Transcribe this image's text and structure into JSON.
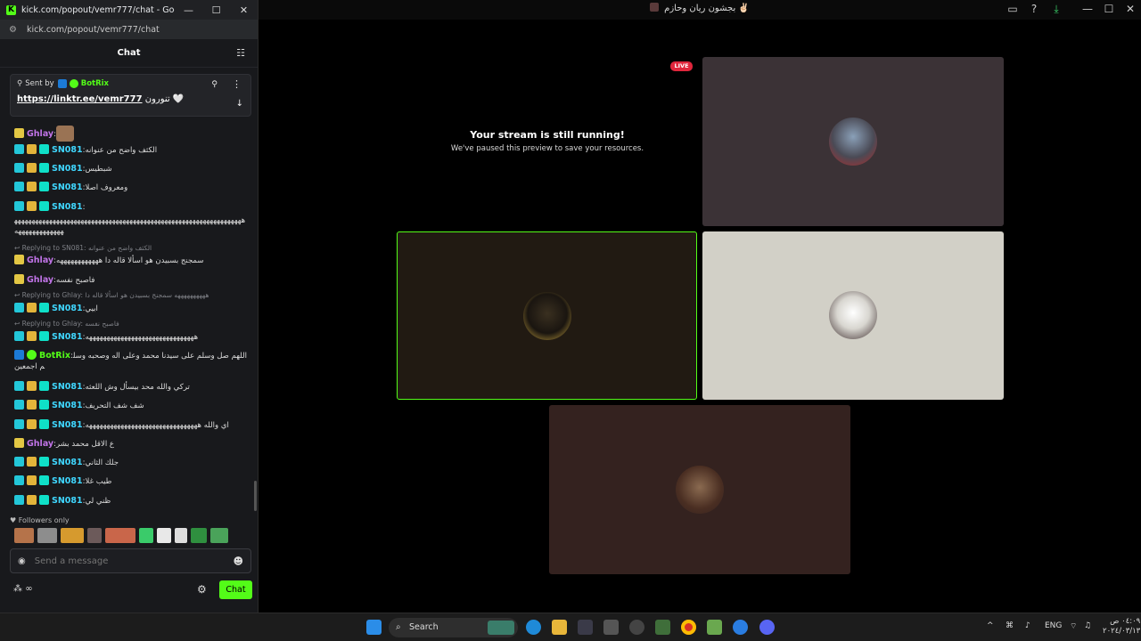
{
  "popout_window": {
    "title": "kick.com/popout/vemr777/chat - Google Chro...",
    "url": "kick.com/popout/vemr777/chat",
    "minimize": "—",
    "maximize": "☐",
    "close": "✕"
  },
  "chat": {
    "header_title": "Chat",
    "pinned": {
      "sent_by_label": "Sent by",
      "sender": "BotRix",
      "link": "https://linktr.ee/vemr777",
      "text": "تنورون 🤍"
    },
    "messages": [
      {
        "user": "Ghlay",
        "text": "",
        "type": "ghlay"
      },
      {
        "user": "SN081",
        "text": ":الكثف واضح من عنوانه",
        "type": "sno"
      },
      {
        "user": "SN081",
        "text": ":شبطيس",
        "type": "sno"
      },
      {
        "user": "SN081",
        "text": ":ومعروف اصلا",
        "type": "sno"
      },
      {
        "user": "SN081",
        "text": ":",
        "type": "sno"
      },
      {
        "user": "",
        "text": "هههههههههههههههههههههههههههههههههههههههههههههههههههههههههههههههههههههههههههههههه",
        "type": "cont"
      },
      {
        "user": "Ghlay",
        "text": ":سمجنج بسبيدن هو اسألا قاله دا ههههههههههههه",
        "type": "ghlay"
      },
      {
        "user": "Ghlay",
        "text": ":فاصبح نفسه",
        "type": "ghlay"
      },
      {
        "user": "SN081",
        "text": ":ابيي",
        "type": "sno"
      },
      {
        "user": "SN081",
        "text": ":هههههههههههههههههههههههههههههههه",
        "type": "sno"
      },
      {
        "user": "BotRix",
        "text": ":اللهم صل وسلم على سيدنا محمد وعلى اله وصحبه وسلم اجمعين",
        "type": "bot"
      },
      {
        "user": "SN081",
        "text": ":تركي والله محد بيسأل وش اللعثه",
        "type": "sno"
      },
      {
        "user": "SN081",
        "text": ":شف شف التحريف",
        "type": "sno"
      },
      {
        "user": "SN081",
        "text": ":اي والله ههههههههههههههههههههههههههههههههه",
        "type": "sno"
      },
      {
        "user": "Ghlay",
        "text": ":ع الاقل محمد بشر",
        "type": "ghlay"
      },
      {
        "user": "SN081",
        "text": ":جلك الثاني",
        "type": "sno"
      },
      {
        "user": "SN081",
        "text": ":طيب غلا",
        "type": "sno"
      },
      {
        "user": "SN081",
        "text": ":ظني لي",
        "type": "sno"
      }
    ],
    "replies": [
      "Replying to SN081: الكثف واضح من عنوانه",
      "Replying to Ghlay: ههههههههههه سمجنج بسبيدن هو اسألا قاله دا",
      "Replying to Ghlay: فاصبح نفسه"
    ],
    "followers_only": "Followers only",
    "input_placeholder": "Send a message",
    "send_label": "Chat",
    "points": "∞"
  },
  "main_window": {
    "title": "بجشون ريان وحازم ✌🏻"
  },
  "stream": {
    "live_label": "LIVE",
    "paused_title": "Your stream is still running!",
    "paused_subtitle": "We've paused this preview to save your resources."
  },
  "taskbar": {
    "search_label": "Search",
    "language": "ENG",
    "time": "٠٤:٠٩ ص",
    "date": "٢٠٢٤/٠٣/١٣"
  }
}
